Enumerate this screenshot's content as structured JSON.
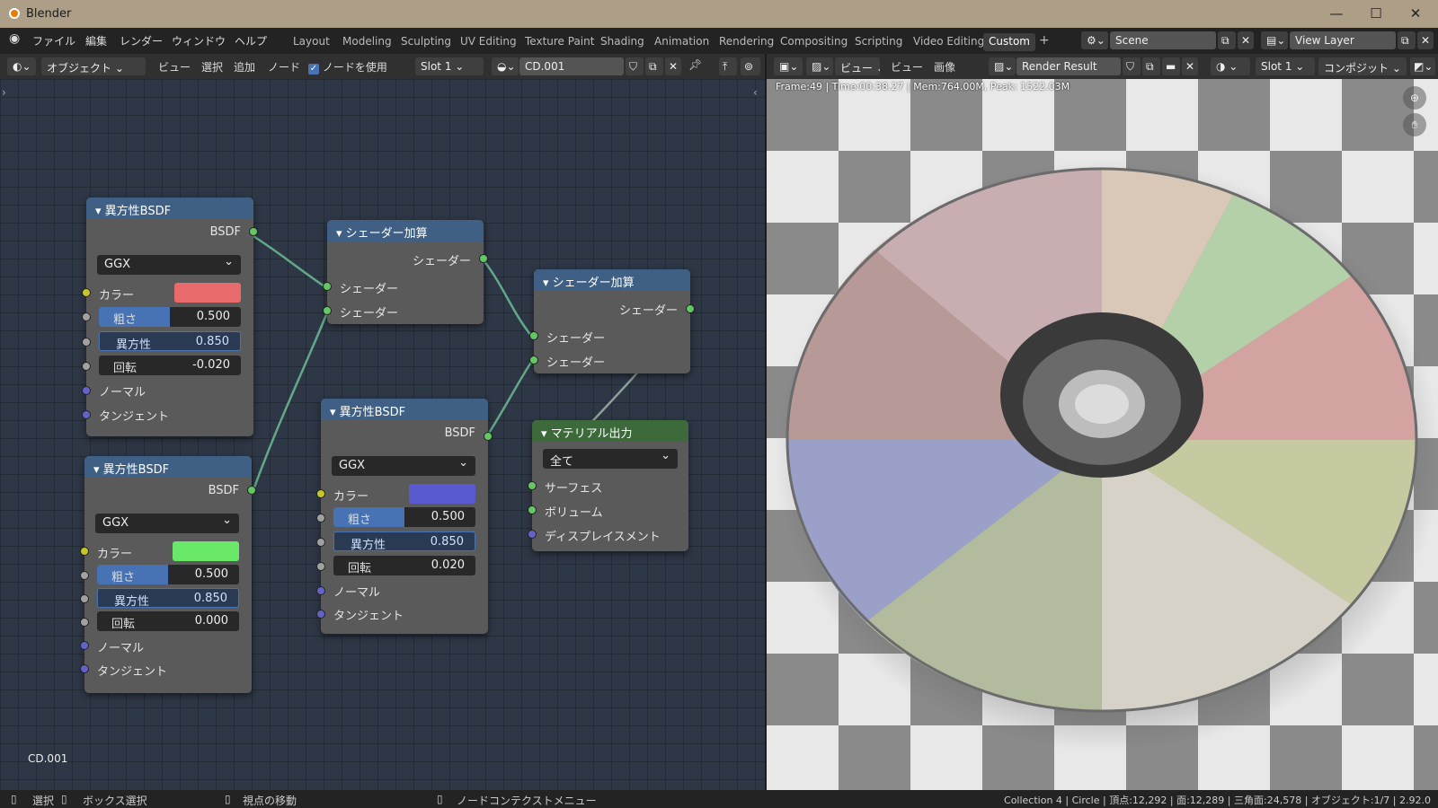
{
  "window": {
    "title": "Blender",
    "min": "—",
    "max": "☐",
    "close": "✕"
  },
  "menu": [
    "ファイル",
    "編集",
    "レンダー",
    "ウィンドウ",
    "ヘルプ"
  ],
  "workspaces": [
    "Layout",
    "Modeling",
    "Sculpting",
    "UV Editing",
    "Texture Paint",
    "Shading",
    "Animation",
    "Rendering",
    "Compositing",
    "Scripting",
    "Video Editing",
    "Custom"
  ],
  "add_tab": "+",
  "scene": "Scene",
  "view_layer": "View Layer",
  "node_header": {
    "mode": "オブジェクト",
    "view": "ビュー",
    "select": "選択",
    "add": "追加",
    "node": "ノード",
    "use_nodes": "ノードを使用",
    "slot": "Slot 1",
    "material": "CD.001"
  },
  "image_header": {
    "view_menu": "ビュー",
    "view": "ビュー",
    "image": "画像",
    "image_name": "Render Result",
    "slot": "Slot 1",
    "pass": "コンポジット"
  },
  "render_info": "Frame:49 | Time:00:38.27 | Mem:764.00M, Peak: 1522.03M",
  "editor_label": "CD.001",
  "nodes": {
    "aniso1": {
      "title": "異方性BSDF",
      "out": "BSDF",
      "dist": "GGX",
      "color_label": "カラー",
      "color": "#e86a6a",
      "rough_label": "粗さ",
      "rough": "0.500",
      "rough_f": 0.5,
      "aniso_label": "異方性",
      "aniso": "0.850",
      "rot_label": "回転",
      "rot": "-0.020",
      "normal": "ノーマル",
      "tangent": "タンジェント"
    },
    "aniso2": {
      "title": "異方性BSDF",
      "out": "BSDF",
      "dist": "GGX",
      "color_label": "カラー",
      "color": "#6ae86a",
      "rough_label": "粗さ",
      "rough": "0.500",
      "rough_f": 0.5,
      "aniso_label": "異方性",
      "aniso": "0.850",
      "rot_label": "回転",
      "rot": "0.000",
      "normal": "ノーマル",
      "tangent": "タンジェント"
    },
    "aniso3": {
      "title": "異方性BSDF",
      "out": "BSDF",
      "dist": "GGX",
      "color_label": "カラー",
      "color": "#5a5ad0",
      "rough_label": "粗さ",
      "rough": "0.500",
      "rough_f": 0.5,
      "aniso_label": "異方性",
      "aniso": "0.850",
      "rot_label": "回転",
      "rot": "0.020",
      "normal": "ノーマル",
      "tangent": "タンジェント"
    },
    "add1": {
      "title": "シェーダー加算",
      "out": "シェーダー",
      "in1": "シェーダー",
      "in2": "シェーダー"
    },
    "add2": {
      "title": "シェーダー加算",
      "out": "シェーダー",
      "in1": "シェーダー",
      "in2": "シェーダー"
    },
    "output": {
      "title": "マテリアル出力",
      "target": "全て",
      "surface": "サーフェス",
      "volume": "ボリューム",
      "displacement": "ディスプレイスメント"
    }
  },
  "status": {
    "select": "選択",
    "box_select": "ボックス選択",
    "pan": "視点の移動",
    "context": "ノードコンテクストメニュー",
    "info": "Collection 4 | Circle | 頂点:12,292 | 面:12,289 | 三角面:24,578 | オブジェクト:1/7 | 2.92.0"
  }
}
